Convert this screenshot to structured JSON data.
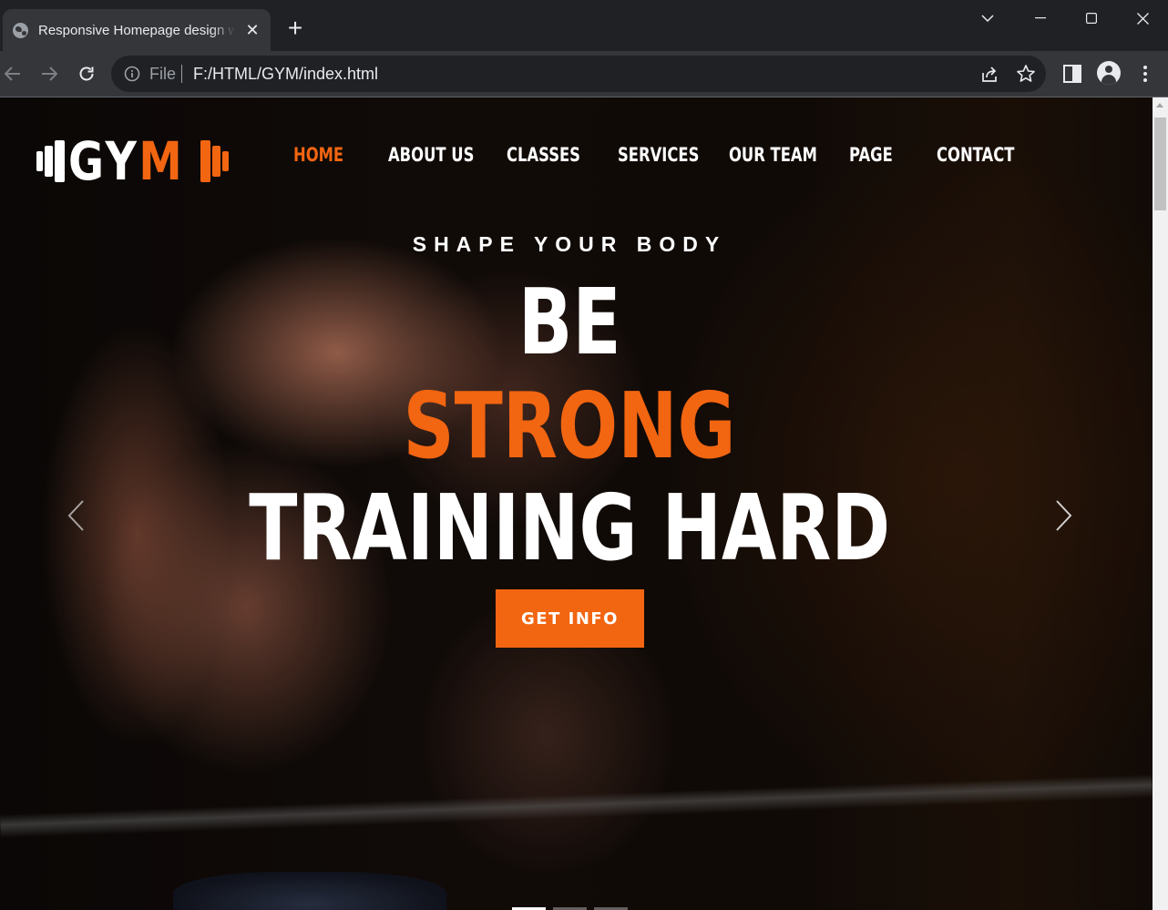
{
  "browser": {
    "tab_title": "Responsive Homepage design with",
    "tab_close": "✕",
    "new_tab": "+",
    "omnibox_scheme_label": "File",
    "url": "F:/HTML/GYM/index.html"
  },
  "site": {
    "logo": {
      "prefix": "GY",
      "accent": "M"
    },
    "nav": [
      {
        "label": "HOME",
        "active": true
      },
      {
        "label": "ABOUT US",
        "active": false
      },
      {
        "label": "CLASSES",
        "active": false
      },
      {
        "label": "SERVICES",
        "active": false
      },
      {
        "label": "OUR TEAM",
        "active": false
      },
      {
        "label": "PAGE",
        "active": false
      },
      {
        "label": "CONTACT",
        "active": false
      }
    ],
    "hero": {
      "subtitle": "SHAPE YOUR BODY",
      "line1": "BE",
      "line2": "STRONG",
      "line3": "TRAINING HARD",
      "cta": "GET INFO"
    },
    "slider": {
      "slide_count": 3,
      "active_slide": 1
    }
  },
  "colors": {
    "accent": "#f26511",
    "chrome_dark": "#202124",
    "chrome_tab": "#35363a"
  },
  "icons": {
    "favicon": "globe-icon",
    "back": "arrow-left-icon",
    "forward": "arrow-right-icon",
    "reload": "reload-icon",
    "info": "info-icon",
    "share": "share-icon",
    "bookmark": "star-icon",
    "side_panel": "side-panel-icon",
    "profile": "profile-icon",
    "menu": "kebab-menu-icon",
    "prev": "chevron-left-icon",
    "next": "chevron-right-icon"
  }
}
